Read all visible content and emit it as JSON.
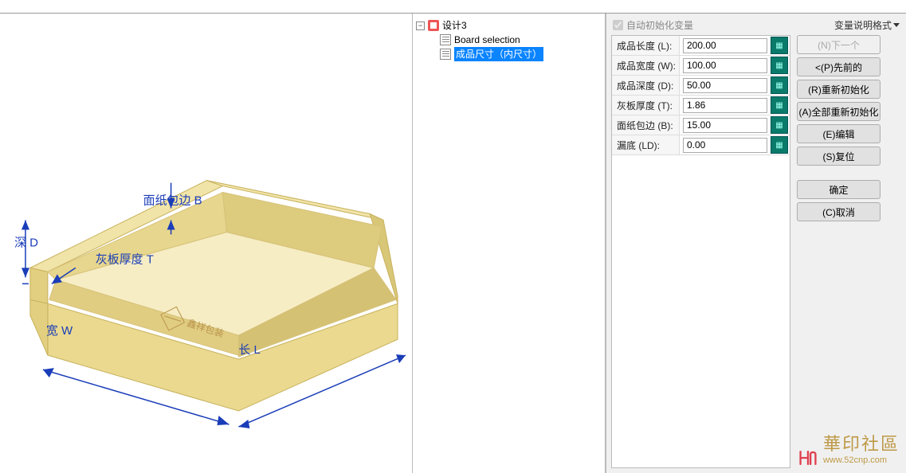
{
  "tree": {
    "root": "设计3",
    "board_selection": "Board selection",
    "selected": "成品尺寸（内尺寸）"
  },
  "panel": {
    "auto_init": "自动初始化变量",
    "format_label": "变量说明格式",
    "params": [
      {
        "label": "成品长度 (L):",
        "value": "200.00"
      },
      {
        "label": "成品宽度 (W):",
        "value": "100.00"
      },
      {
        "label": "成品深度 (D):",
        "value": "50.00"
      },
      {
        "label": "灰板厚度 (T):",
        "value": "1.86"
      },
      {
        "label": "面纸包边 (B):",
        "value": "15.00"
      },
      {
        "label": "漏底 (LD):",
        "value": "0.00"
      }
    ]
  },
  "buttons": {
    "next": "(N)下一个",
    "prev": "<(P)先前的",
    "reinit": "(R)重新初始化",
    "reinit_all": "(A)全部重新初始化",
    "edit": "(E)编辑",
    "reset": "(S)复位",
    "ok": "确定",
    "cancel": "(C)取消"
  },
  "annotations": {
    "length": "长 L",
    "width": "宽 W",
    "depth": "深 D",
    "thickness": "灰板厚度 T",
    "wrap": "面纸包边 B",
    "brand": "鑫祥包装"
  },
  "watermark": {
    "cn": "華印社區",
    "url": "www.52cnp.com"
  }
}
